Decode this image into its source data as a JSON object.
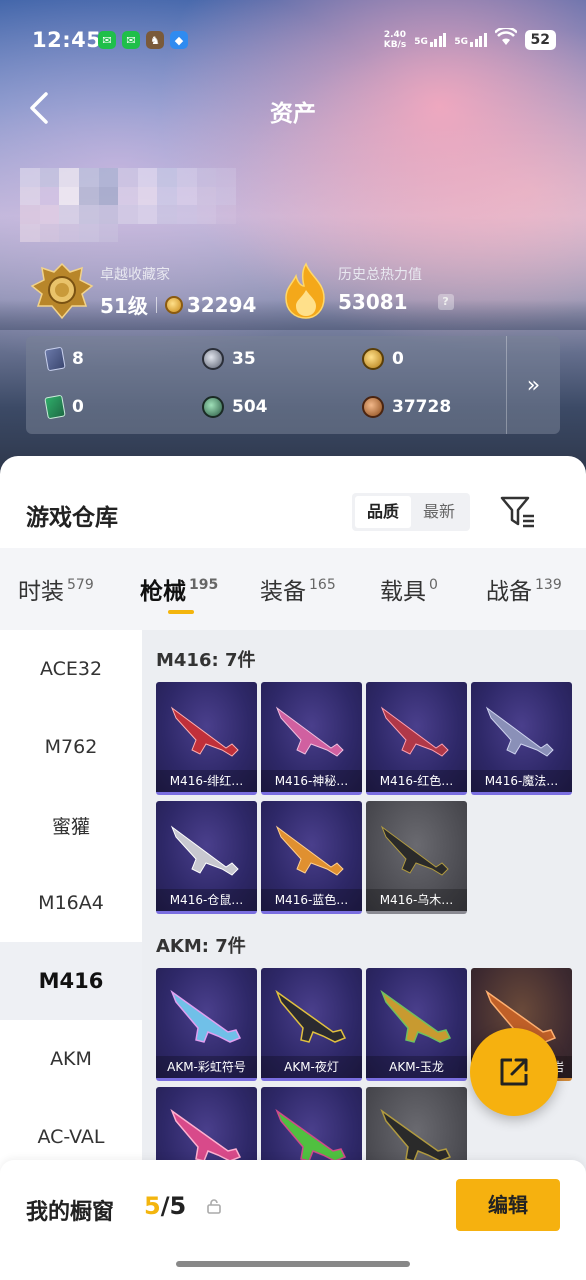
{
  "status_bar": {
    "time": "12:45",
    "app_icons": [
      "wechat-icon",
      "wechat-icon",
      "game-icon",
      "browser-icon"
    ],
    "net_speed_value": "2.40",
    "net_speed_unit": "KB/s",
    "signal1_label": "5G",
    "signal2_label": "5G",
    "battery": "52"
  },
  "nav": {
    "title": "资产"
  },
  "profile": {
    "collector_title": "卓越收藏家",
    "level": "51级",
    "coins": "32294",
    "heat_label": "历史总热力值",
    "heat_value": "53081",
    "help": "?"
  },
  "stats": [
    {
      "icon": "blue-card-icon",
      "value": "8"
    },
    {
      "icon": "silver-coin-icon",
      "value": "35"
    },
    {
      "icon": "gold-coin-icon",
      "value": "0"
    },
    {
      "icon": "green-card-icon",
      "value": "0"
    },
    {
      "icon": "green-orb-icon",
      "value": "504"
    },
    {
      "icon": "bronze-coin-icon",
      "value": "37728"
    }
  ],
  "stats_more": "»",
  "warehouse": {
    "title": "游戏仓库",
    "sort_options": [
      "品质",
      "最新"
    ],
    "sort_active": "品质"
  },
  "categories": [
    {
      "label": "时装",
      "count": "579"
    },
    {
      "label": "枪械",
      "count": "195"
    },
    {
      "label": "装备",
      "count": "165"
    },
    {
      "label": "载具",
      "count": "0"
    },
    {
      "label": "战备",
      "count": "139"
    }
  ],
  "weapons": [
    "ACE32",
    "M762",
    "蜜獾",
    "M16A4",
    "M416",
    "AKM",
    "AC-VAL"
  ],
  "active_weapon": "M416",
  "groups": [
    {
      "title": "M416: 7件",
      "skins": [
        "M416-绯红…",
        "M416-神秘…",
        "M416-红色…",
        "M416-魔法…",
        "M416-仓鼠…",
        "M416-蓝色…",
        "M416-乌木…"
      ]
    },
    {
      "title": "AKM: 7件",
      "skins": [
        "AKM-彩虹符号",
        "AKM-夜灯",
        "AKM-玉龙",
        "岩",
        "",
        "",
        ""
      ]
    }
  ],
  "showcase": {
    "label": "我的橱窗",
    "current": "5",
    "separator": "/",
    "total": "5"
  },
  "edit_label": "编辑",
  "colors": {
    "accent": "#f6b10f",
    "rare_purple": "#2e2868",
    "common_grey": "#4a4a50"
  }
}
